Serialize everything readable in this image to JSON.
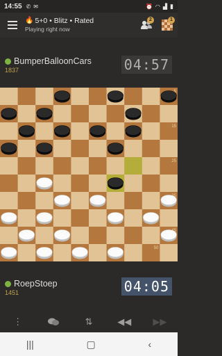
{
  "status_bar": {
    "time": "14:55",
    "left_icons": [
      "whatsapp-icon",
      "gmail-icon"
    ],
    "right_icons": [
      "alarm-icon",
      "wifi-icon",
      "signal-icon",
      "battery-icon"
    ]
  },
  "toolbar": {
    "title": "5+0 • Blitz • Rated",
    "subtitle": "Playing right now",
    "friends_badge": "2",
    "games_badge": "1"
  },
  "opponent": {
    "name": "BumperBalloonCars",
    "rating": "1837",
    "clock": "04:57",
    "online": true
  },
  "player": {
    "name": "RoepStoep",
    "rating": "1451",
    "clock": "04:05",
    "online": true
  },
  "board": {
    "size": 10,
    "light_color": "#e2c396",
    "dark_color": "#b4773e",
    "highlight_color": "#b5ad3a",
    "square_numbers": [
      "5",
      "15",
      "25",
      "35",
      "45",
      "50"
    ],
    "black_pieces": [
      [
        0,
        3
      ],
      [
        0,
        6
      ],
      [
        0,
        9
      ],
      [
        1,
        0
      ],
      [
        1,
        2
      ],
      [
        1,
        7
      ],
      [
        2,
        1
      ],
      [
        2,
        3
      ],
      [
        2,
        5
      ],
      [
        2,
        7
      ],
      [
        3,
        0
      ],
      [
        3,
        2
      ],
      [
        3,
        6
      ],
      [
        5,
        6
      ]
    ],
    "white_pieces": [
      [
        5,
        2
      ],
      [
        6,
        3
      ],
      [
        6,
        5
      ],
      [
        6,
        9
      ],
      [
        7,
        0
      ],
      [
        7,
        2
      ],
      [
        7,
        6
      ],
      [
        7,
        8
      ],
      [
        8,
        1
      ],
      [
        8,
        3
      ],
      [
        8,
        9
      ],
      [
        9,
        0
      ],
      [
        9,
        2
      ],
      [
        9,
        4
      ],
      [
        9,
        6
      ]
    ],
    "highlighted": [
      [
        4,
        7
      ],
      [
        5,
        6
      ]
    ]
  },
  "controls": [
    "more-icon",
    "chat-icon",
    "flip-board-icon",
    "previous-move-icon",
    "next-move-icon"
  ],
  "system_nav": [
    "recent-apps-icon",
    "home-icon",
    "back-icon"
  ]
}
